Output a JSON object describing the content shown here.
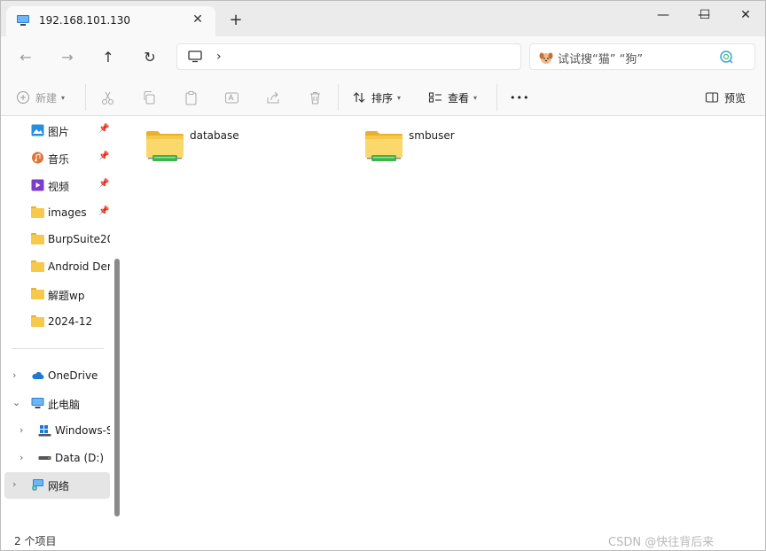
{
  "titlebar": {
    "tab_title": "192.168.101.130",
    "tab_close": "✕",
    "new_tab": "+",
    "minimize": "—",
    "maximize": "☐",
    "close": "✕"
  },
  "nav": {
    "back": "←",
    "forward": "→",
    "up": "↑",
    "refresh": "↻",
    "address_chevron": "›",
    "search_placeholder": "试试搜“猫” “狗”"
  },
  "toolbar": {
    "new_label": "新建",
    "sort_label": "排序",
    "view_label": "查看",
    "more_label": "•••",
    "preview_label": "预览"
  },
  "sidebar": {
    "quick_access": [
      {
        "label": "图片",
        "pinned": true
      },
      {
        "label": "音乐",
        "pinned": true
      },
      {
        "label": "视频",
        "pinned": true
      },
      {
        "label": "images",
        "pinned": true
      },
      {
        "label": "BurpSuite20",
        "pinned": false
      },
      {
        "label": "Android Der",
        "pinned": false
      },
      {
        "label": "解题wp",
        "pinned": false
      },
      {
        "label": "2024-12",
        "pinned": false
      }
    ],
    "tree": [
      {
        "label": "OneDrive",
        "expand": "›"
      },
      {
        "label": "此电脑",
        "expand": "⌄"
      },
      {
        "label": "Windows-S",
        "expand": "›"
      },
      {
        "label": "Data (D:)",
        "expand": "›"
      },
      {
        "label": "网络",
        "expand": "›"
      }
    ]
  },
  "content": {
    "items": [
      {
        "name": "database",
        "type": "network-share"
      },
      {
        "name": "smbuser",
        "type": "network-share"
      }
    ]
  },
  "status": {
    "item_count": "2 个项目",
    "watermark": "CSDN @快往背后来"
  },
  "colors": {
    "folder": "#f7c94a",
    "share_bar": "#3cb44a",
    "selected_bg": "#e5e5e5"
  }
}
